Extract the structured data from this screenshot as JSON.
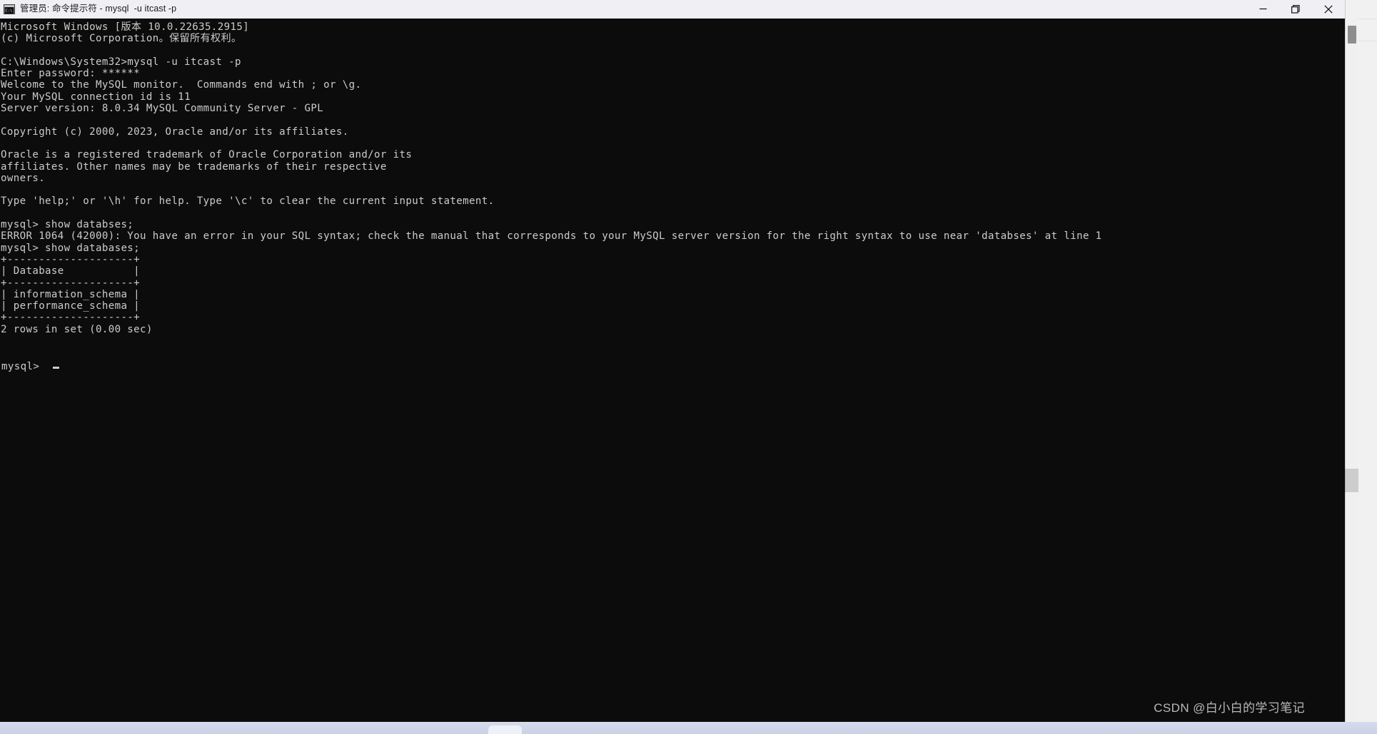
{
  "window": {
    "title": "管理员: 命令提示符 - mysql  -u itcast -p",
    "icon": "cmd-console-icon",
    "controls": {
      "minimize_label": "—",
      "restore_label": "restore-icon",
      "close_label": "✕"
    },
    "colors": {
      "titlebar_bg": "#f0f0f4",
      "console_bg": "#0c0c0c",
      "console_fg": "#cccccc",
      "close_hover": "#e81123"
    }
  },
  "terminal": {
    "prompt_symbol": "mysql>",
    "cursor": "block-cursor",
    "lines": [
      "Microsoft Windows [版本 10.0.22635.2915]",
      "(c) Microsoft Corporation。保留所有权利。",
      "",
      "C:\\Windows\\System32>mysql -u itcast -p",
      "Enter password: ******",
      "Welcome to the MySQL monitor.  Commands end with ; or \\g.",
      "Your MySQL connection id is 11",
      "Server version: 8.0.34 MySQL Community Server - GPL",
      "",
      "Copyright (c) 2000, 2023, Oracle and/or its affiliates.",
      "",
      "Oracle is a registered trademark of Oracle Corporation and/or its",
      "affiliates. Other names may be trademarks of their respective",
      "owners.",
      "",
      "Type 'help;' or '\\h' for help. Type '\\c' to clear the current input statement.",
      "",
      "mysql> show databses;",
      "ERROR 1064 (42000): You have an error in your SQL syntax; check the manual that corresponds to your MySQL server version for the right syntax to use near 'databses' at line 1",
      "mysql> show databases;",
      "+--------------------+",
      "| Database           |",
      "+--------------------+",
      "| information_schema |",
      "| performance_schema |",
      "+--------------------+",
      "2 rows in set (0.00 sec)",
      ""
    ],
    "final_prompt": "mysql>",
    "commands": [
      "mysql -u itcast -p",
      "show databses;",
      "show databases;"
    ],
    "password_masked": "******",
    "mysql_connection_id": "11",
    "server_version": "8.0.34 MySQL Community Server - GPL",
    "windows_version": "10.0.22635.2915",
    "copyright_years": "2000, 2023",
    "error": {
      "code": "1064",
      "sqlstate": "42000",
      "message": "You have an error in your SQL syntax; check the manual that corresponds to your MySQL server version for the right syntax to use near 'databses' at line 1"
    },
    "result_table": {
      "header": [
        "Database"
      ],
      "rows": [
        [
          "information_schema"
        ],
        [
          "performance_schema"
        ]
      ],
      "summary": "2 rows in set (0.00 sec)",
      "row_count": "2",
      "elapsed": "0.00 sec"
    }
  },
  "watermark": {
    "text": "CSDN @白小白的学习笔记"
  }
}
